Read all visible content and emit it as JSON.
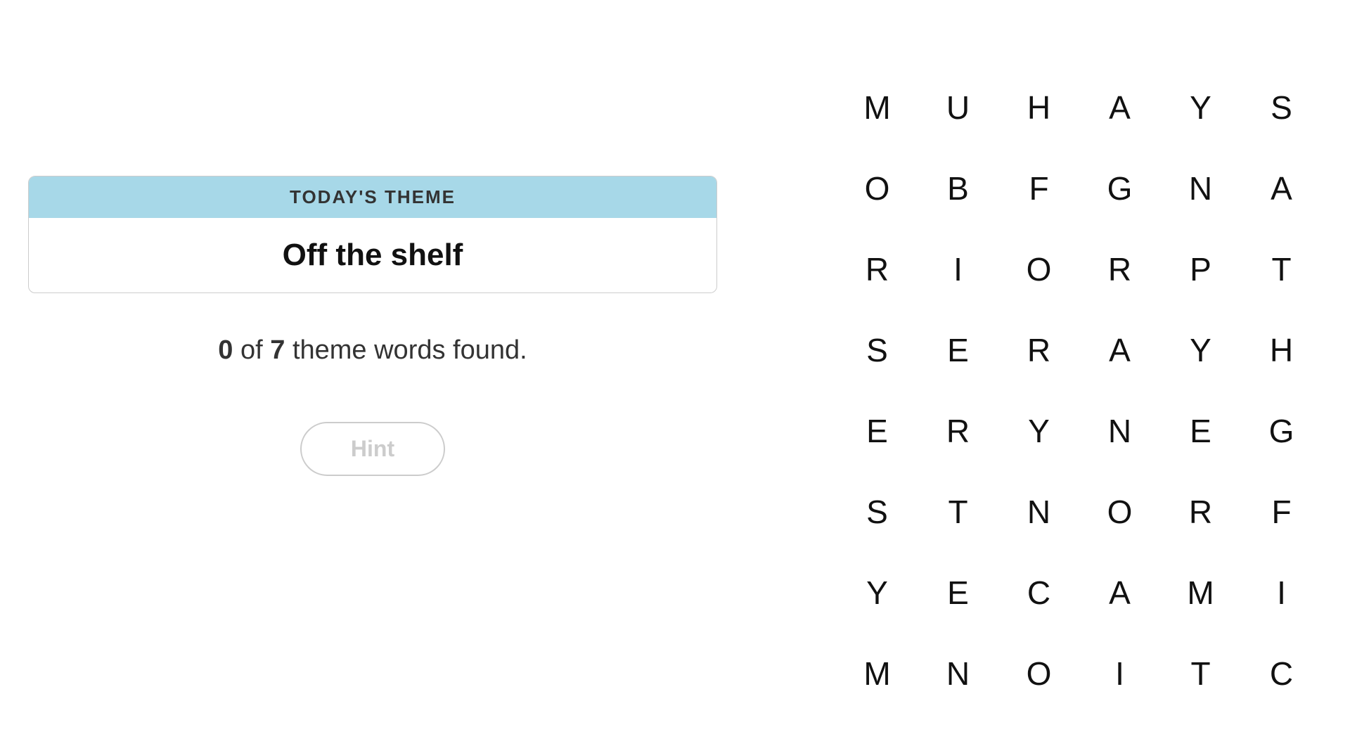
{
  "theme": {
    "header_label": "TODAY'S THEME",
    "title": "Off the shelf"
  },
  "progress": {
    "found": "0",
    "separator": " of ",
    "total": "7",
    "suffix": " theme words found."
  },
  "hint_button_label": "Hint",
  "grid": {
    "rows": [
      [
        "M",
        "U",
        "H",
        "A",
        "Y",
        "S"
      ],
      [
        "O",
        "B",
        "F",
        "G",
        "N",
        "A"
      ],
      [
        "R",
        "I",
        "O",
        "R",
        "P",
        "T"
      ],
      [
        "S",
        "E",
        "R",
        "A",
        "Y",
        "H"
      ],
      [
        "E",
        "R",
        "Y",
        "N",
        "E",
        "G"
      ],
      [
        "S",
        "T",
        "N",
        "O",
        "R",
        "F"
      ],
      [
        "Y",
        "E",
        "C",
        "A",
        "M",
        "I"
      ],
      [
        "M",
        "N",
        "O",
        "I",
        "T",
        "C"
      ]
    ]
  }
}
